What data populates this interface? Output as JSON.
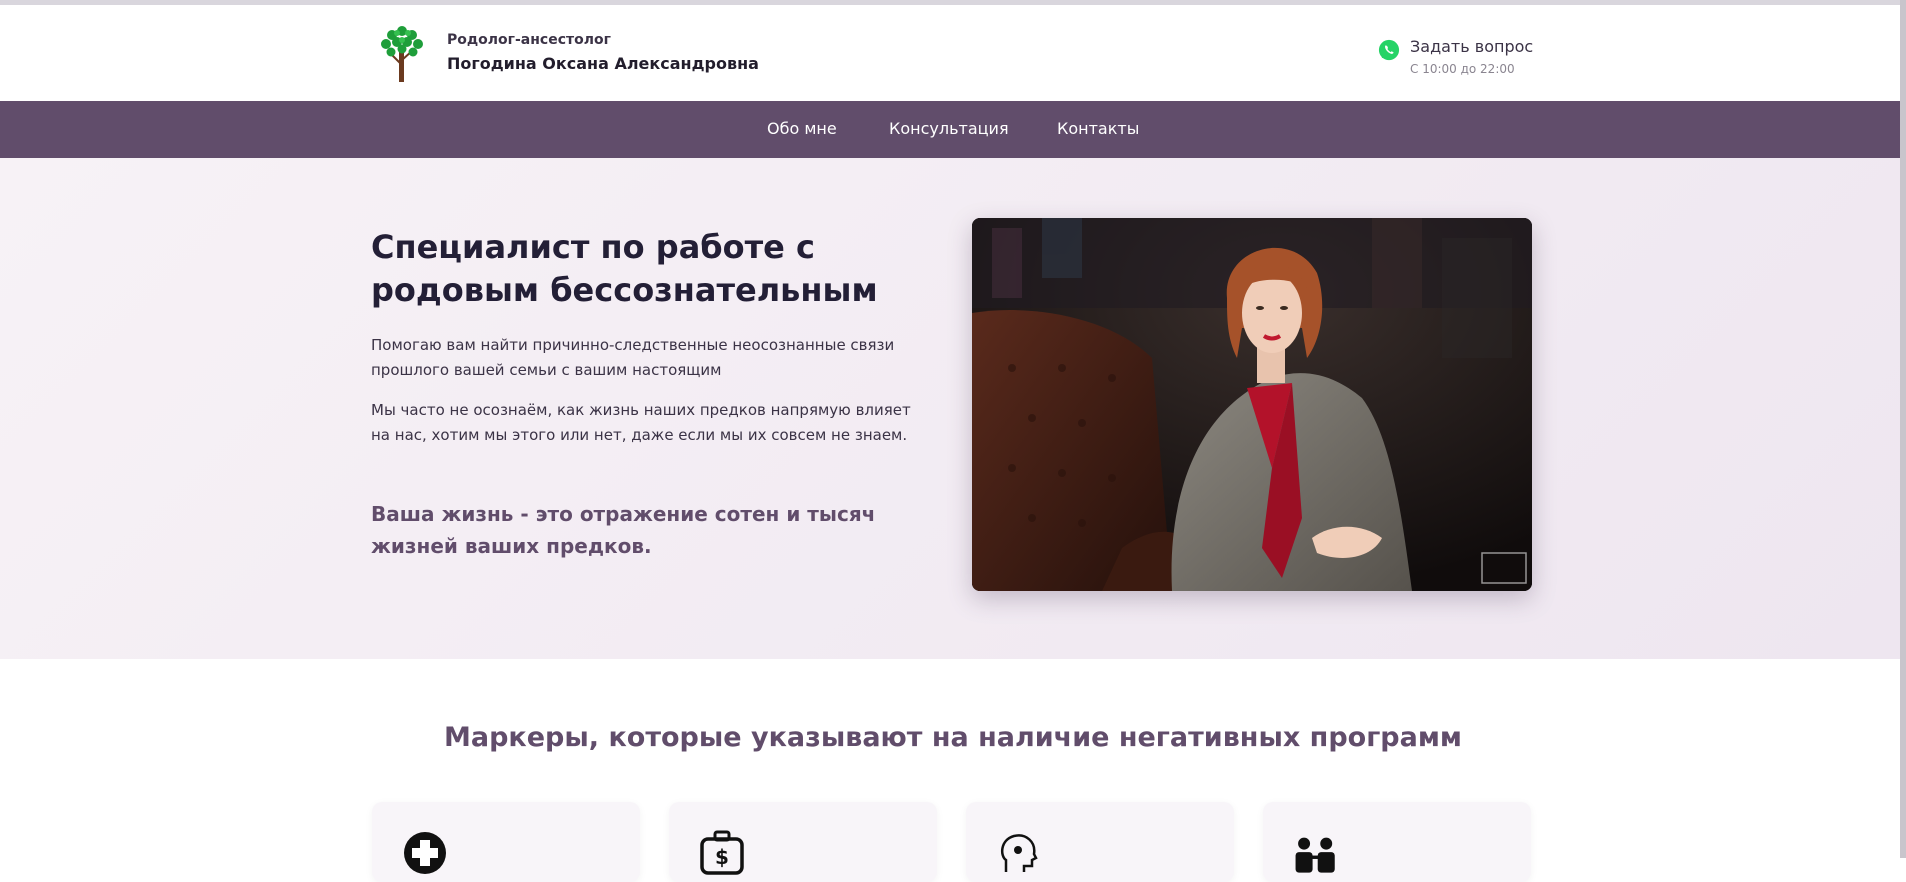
{
  "header": {
    "subtitle": "Родолог-ансестолог",
    "name": "Погодина Оксана Александровна",
    "ask_label": "Задать вопрос",
    "hours": "С 10:00 до 22:00",
    "logo_icon": "tree-icon",
    "contact_icon": "whatsapp-icon"
  },
  "nav": {
    "items": [
      {
        "label": "Обо мне"
      },
      {
        "label": "Консультация"
      },
      {
        "label": "Контакты"
      }
    ]
  },
  "hero": {
    "title": "Специалист по работе с родовым бессознательным",
    "paragraph1": "Помогаю вам найти причинно-следственные неосознанные связи прошлого вашей семьи с вашим настоящим",
    "paragraph2": "Мы часто не осознаём, как жизнь наших предков напрямую влияет на нас, хотим мы этого или нет, даже если мы их совсем не знаем.",
    "quote": "Ваша жизнь - это отражение сотен и тысяч жизней ваших предков."
  },
  "markers": {
    "title": "Маркеры, которые указывают на наличие негативных программ",
    "cards": [
      {
        "icon": "medical-cross-icon"
      },
      {
        "icon": "money-bag-icon"
      },
      {
        "icon": "head-idea-icon"
      },
      {
        "icon": "people-icon"
      }
    ]
  },
  "colors": {
    "accent": "#614d6b",
    "title": "#231f36",
    "whatsapp": "#25d366",
    "hero_bg": "#f3edf4"
  }
}
